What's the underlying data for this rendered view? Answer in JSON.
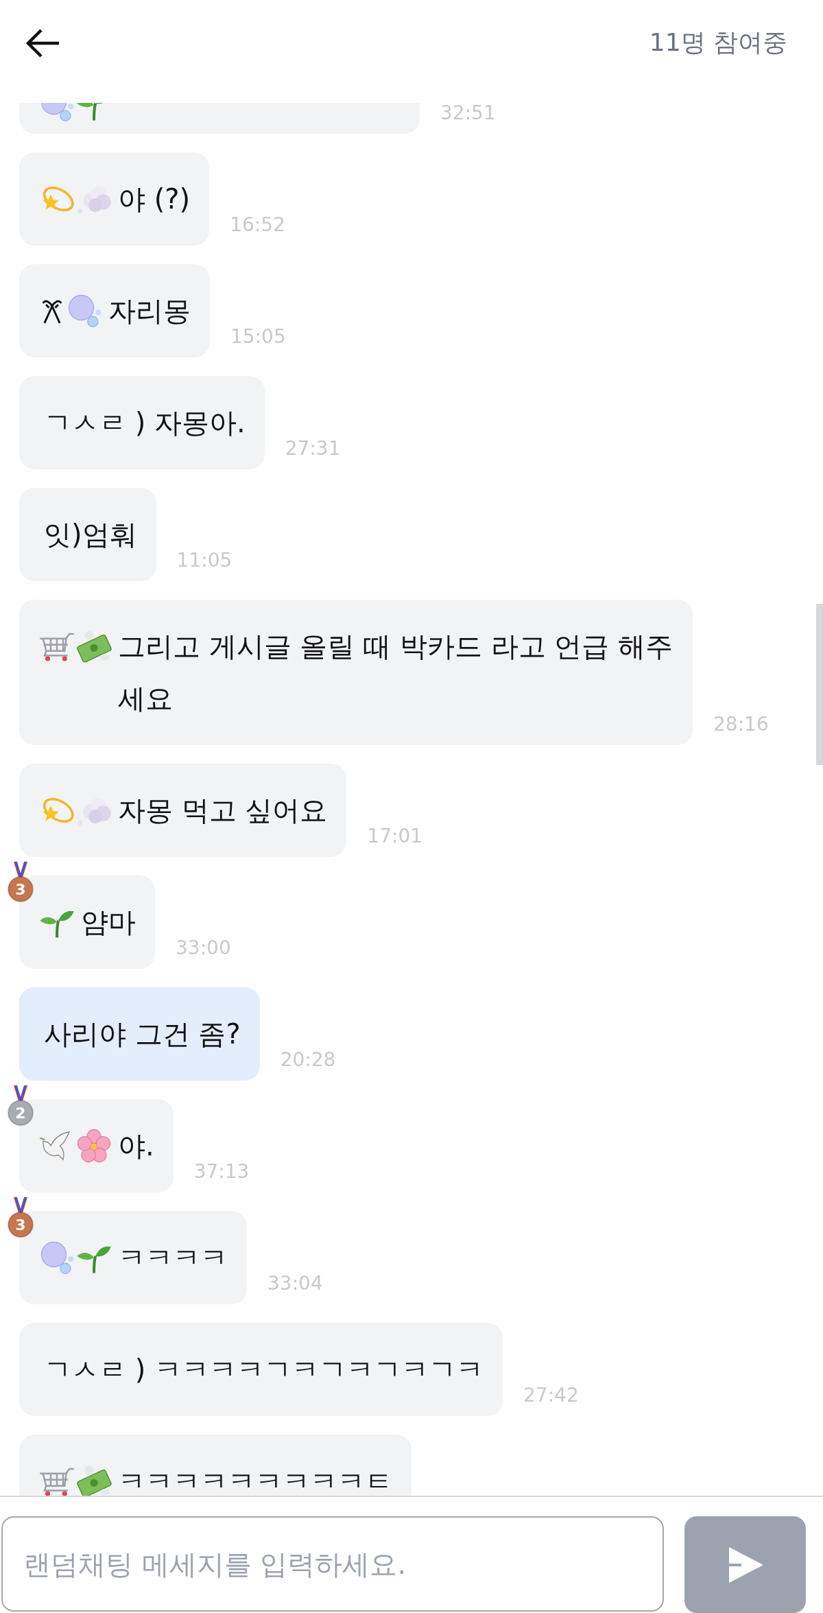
{
  "header": {
    "participants": "11명 참여중"
  },
  "messages": [
    {
      "kind": "bubblesprout",
      "time": "32:51",
      "own": false
    },
    {
      "kind": "dizzycloud",
      "text": "야 (?)",
      "time": "16:52",
      "own": false
    },
    {
      "kind": "ribbonbubbles",
      "text": "자리몽",
      "time": "15:05",
      "own": false
    },
    {
      "kind": "plain",
      "text": "ㄱㅅㄹ ) 자몽아.",
      "time": "27:31",
      "own": false
    },
    {
      "kind": "plain",
      "text": "잇)엄훠",
      "time": "11:05",
      "own": false
    },
    {
      "kind": "cartmoney",
      "text": "그리고 게시글 올릴 때 박카드 라고 언급 해주세요",
      "time": "28:16",
      "own": false
    },
    {
      "kind": "dizzycloud",
      "text": "자몽 먹고 싶어요",
      "time": "17:01",
      "own": false
    },
    {
      "medal": {
        "rank": "3",
        "color": "#c8764e"
      },
      "kind": "sprout",
      "text": "얌마",
      "time": "33:00",
      "own": false
    },
    {
      "kind": "plain",
      "text": "사리야 그건 좀?",
      "time": "20:28",
      "own": true
    },
    {
      "medal": {
        "rank": "2",
        "color": "#a9acb3"
      },
      "kind": "doveflower",
      "text": "야.",
      "time": "37:13",
      "own": false
    },
    {
      "medal": {
        "rank": "3",
        "color": "#c8764e"
      },
      "kind": "bubblesprout",
      "text": "ㅋㅋㅋㅋ",
      "time": "33:04",
      "own": false
    },
    {
      "kind": "plain",
      "text": "ㄱㅅㄹ ) ㅋㅋㅋㅋㄱㅋㄱㅋㄱㅋㄱㅋ",
      "time": "27:42",
      "own": false
    },
    {
      "kind": "cartmoney",
      "text": "ㅋㅋㅋㅋㅋㅋㅋㅋㅋㅌ",
      "own": false
    }
  ],
  "composer": {
    "placeholder": "랜덤채팅 메세지를 입력하세요."
  }
}
